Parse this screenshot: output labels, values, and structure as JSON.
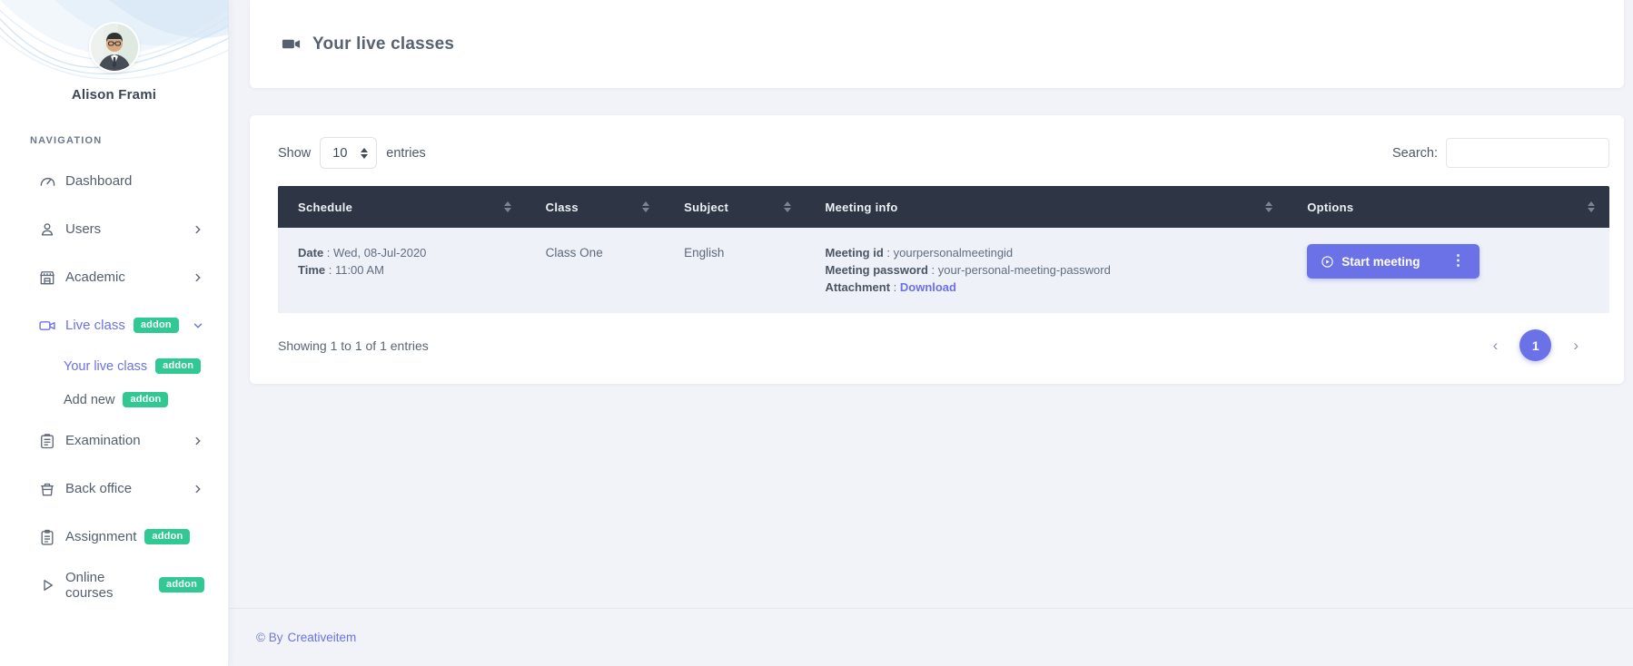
{
  "user": {
    "name": "Alison Frami"
  },
  "sidebar": {
    "section_label": "NAVIGATION",
    "items": [
      {
        "label": "Dashboard"
      },
      {
        "label": "Users"
      },
      {
        "label": "Academic"
      },
      {
        "label": "Live class",
        "badge": "addon"
      },
      {
        "label": "Your live class",
        "badge": "addon"
      },
      {
        "label": "Add new",
        "badge": "addon"
      },
      {
        "label": "Examination"
      },
      {
        "label": "Back office"
      },
      {
        "label": "Assignment",
        "badge": "addon"
      },
      {
        "label": "Online courses",
        "badge": "addon"
      }
    ]
  },
  "page": {
    "title": "Your live classes"
  },
  "controls": {
    "show_label": "Show",
    "page_size": "10",
    "entries_label": "entries",
    "search_label": "Search:",
    "search_value": ""
  },
  "table": {
    "columns": [
      "Schedule",
      "Class",
      "Subject",
      "Meeting info",
      "Options"
    ],
    "row": {
      "sep": " : ",
      "date_label": "Date",
      "date_value": "Wed, 08-Jul-2020",
      "time_label": "Time",
      "time_value": "11:00 AM",
      "class_value": "Class One",
      "subject_value": "English",
      "meeting_id_label": "Meeting id",
      "meeting_id_value": "yourpersonalmeetingid",
      "meeting_password_label": "Meeting password",
      "meeting_password_value": "your-personal-meeting-password",
      "attachment_label": "Attachment",
      "attachment_link": "Download",
      "start_button_label": "Start meeting"
    }
  },
  "pagination": {
    "summary": "Showing 1 to 1 of 1 entries",
    "current_page": "1"
  },
  "footer": {
    "copyright_prefix": "© By",
    "brand_link": "Creativeitem"
  },
  "colors": {
    "accent": "#6b72e8",
    "badge_green": "#30c893",
    "table_header_bg": "#2e3544",
    "row_bg": "#eef1f8",
    "page_bg": "#f1f3f8"
  }
}
